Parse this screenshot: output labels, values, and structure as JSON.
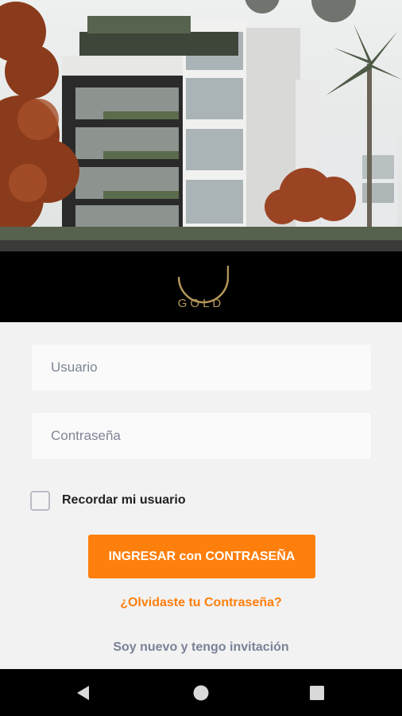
{
  "brand": {
    "name": "GOLD",
    "accent": "#b4975a"
  },
  "login": {
    "username_placeholder": "Usuario",
    "password_placeholder": "Contraseña",
    "remember_label": "Recordar mi usuario",
    "remember_checked": false,
    "submit_label": "INGRESAR con CONTRASEÑA",
    "forgot_label": "¿Olvidaste tu Contraseña?",
    "invite_label": "Soy nuevo y tengo invitación"
  },
  "colors": {
    "primary": "#ff7f0c",
    "secondary_link": "#7a8296",
    "band": "#000000"
  },
  "navbar": {
    "icons": [
      "back-icon",
      "home-icon",
      "recents-icon"
    ]
  }
}
